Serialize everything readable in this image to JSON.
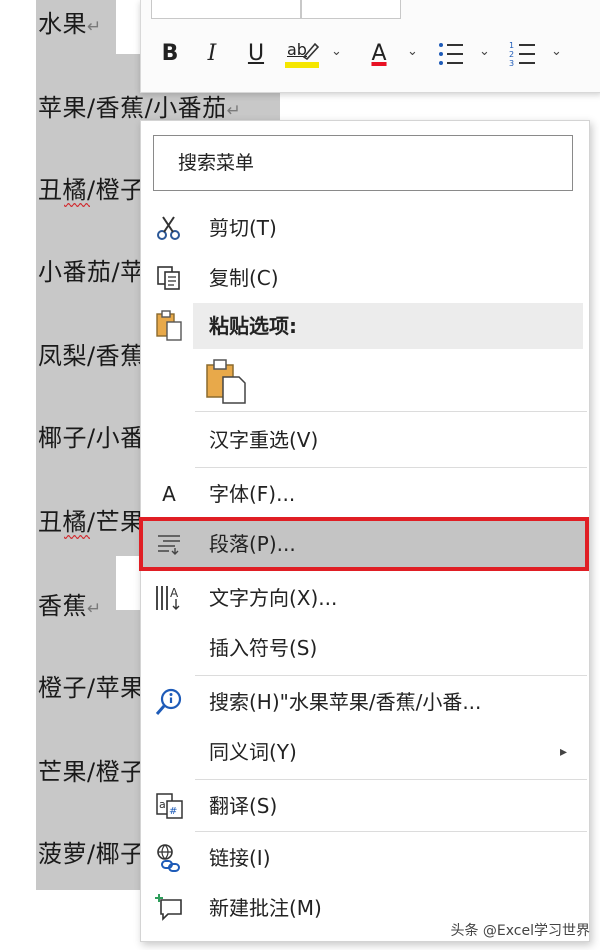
{
  "document": {
    "lines": [
      {
        "text": "水果",
        "mark": "↵"
      },
      {
        "text": "苹果/香蕉/小番茄",
        "mark": "↵"
      },
      {
        "text": "丑橘/橙子",
        "mark": ""
      },
      {
        "text": "小番茄/苹",
        "mark": ""
      },
      {
        "text": "凤梨/香蕉",
        "mark": ""
      },
      {
        "text": "椰子/小番",
        "mark": ""
      },
      {
        "text": "丑橘/芒果",
        "mark": ""
      },
      {
        "text": "香蕉",
        "mark": "↵"
      },
      {
        "text": "橙子/苹果",
        "mark": ""
      },
      {
        "text": "芒果/橙子",
        "mark": ""
      },
      {
        "text": "菠萝/椰子",
        "mark": ""
      }
    ]
  },
  "mini_toolbar": {
    "bold": "B",
    "italic": "I",
    "underline": "U",
    "highlight": "ab",
    "font_color": "A",
    "highlight_color": "#f5e600",
    "font_color_bar": "#e81123"
  },
  "context_menu": {
    "search_placeholder": "搜索菜单",
    "items": {
      "cut": "剪切(T)",
      "copy": "复制(C)",
      "paste_options": "粘贴选项:",
      "reconvert": "汉字重选(V)",
      "font": "字体(F)...",
      "paragraph": "段落(P)...",
      "text_direction": "文字方向(X)...",
      "insert_symbol": "插入符号(S)",
      "search": "搜索(H)\"水果苹果/香蕉/小番...",
      "synonyms": "同义词(Y)",
      "translate": "翻译(S)",
      "link": "链接(I)",
      "new_comment": "新建批注(M)"
    },
    "submenu_arrow": "▸",
    "highlight_color": "#e01e24"
  },
  "watermark": "头条 @Excel学习世界"
}
